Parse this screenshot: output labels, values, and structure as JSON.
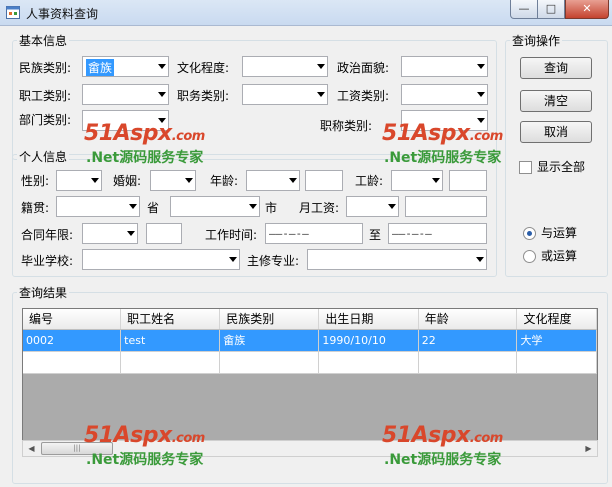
{
  "window": {
    "title": "人事资料查询",
    "min_glyph": "—",
    "max_glyph": "□",
    "close_glyph": "✕"
  },
  "basic_info": {
    "group_label": "基本信息",
    "ethnicity_label": "民族类别:",
    "ethnicity_value": "畲族",
    "education_label": "文化程度:",
    "political_label": "政治面貌:",
    "employee_type_label": "职工类别:",
    "position_type_label": "职务类别:",
    "salary_type_label": "工资类别:",
    "department_label": "部门类别:",
    "title_type_label": "职称类别:"
  },
  "personal_info": {
    "group_label": "个人信息",
    "gender_label": "性别:",
    "marriage_label": "婚姻:",
    "age_label": "年龄:",
    "seniority_label": "工龄:",
    "native_label": "籍贯:",
    "province_label": "省",
    "city_label": "市",
    "monthly_salary_label": "月工资:",
    "contract_label": "合同年限:",
    "work_time_label": "工作时间:",
    "date_placeholder": "——-—-—",
    "to_label": "至",
    "school_label": "毕业学校:",
    "major_label": "主修专业:"
  },
  "operations": {
    "group_label": "查询操作",
    "query_button": "查询",
    "clear_button": "清空",
    "cancel_button": "取消",
    "show_all_label": "显示全部",
    "and_label": "与运算",
    "or_label": "或运算",
    "selected_logic": "and"
  },
  "results": {
    "group_label": "查询结果",
    "columns": [
      "编号",
      "职工姓名",
      "民族类别",
      "出生日期",
      "年龄",
      "文化程度"
    ],
    "rows": [
      [
        "0002",
        "test",
        "畲族",
        "1990/10/10",
        "22",
        "大学"
      ]
    ]
  },
  "watermark": {
    "logo": "51Aspx",
    "logo_suffix": ".com",
    "tagline": ".Net源码服务专家"
  },
  "colors": {
    "selection": "#3399ff",
    "watermark_logo": "#d9472b",
    "watermark_tag": "#3a9a3a"
  },
  "icons": [
    "app-icon",
    "dropdown-arrow-icon",
    "scroll-left-icon",
    "scroll-right-icon"
  ]
}
